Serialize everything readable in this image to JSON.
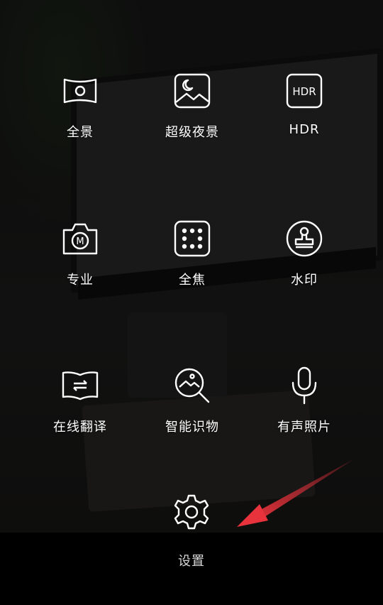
{
  "modes": [
    {
      "label": "全景",
      "icon": "panorama-icon"
    },
    {
      "label": "超级夜景",
      "icon": "night-scene-icon"
    },
    {
      "label": "HDR",
      "icon": "hdr-icon",
      "icon_text": "HDR"
    },
    {
      "label": "专业",
      "icon": "pro-mode-icon",
      "icon_text": "M"
    },
    {
      "label": "全焦",
      "icon": "all-focus-icon"
    },
    {
      "label": "水印",
      "icon": "watermark-stamp-icon"
    },
    {
      "label": "在线翻译",
      "icon": "translate-book-icon"
    },
    {
      "label": "智能识物",
      "icon": "object-recognition-icon"
    },
    {
      "label": "有声照片",
      "icon": "microphone-icon"
    }
  ],
  "settings": {
    "label": "设置",
    "icon": "gear-icon"
  },
  "colors": {
    "annotation_arrow": "#e8323c",
    "icon_stroke": "#ffffff",
    "bottom_bar": "#000000"
  }
}
